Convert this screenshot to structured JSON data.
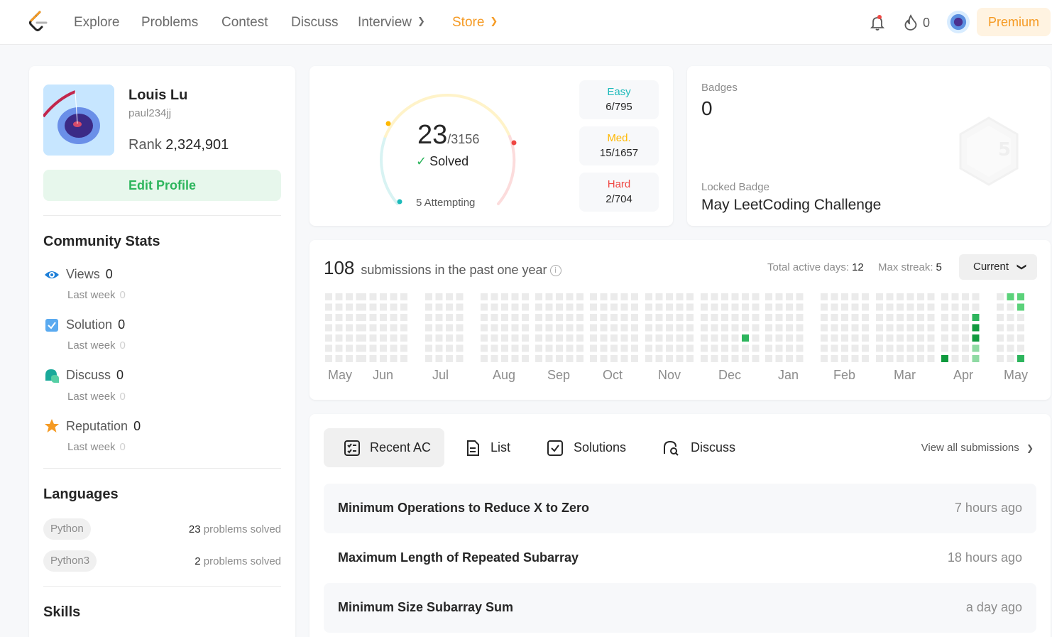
{
  "nav": {
    "items": [
      {
        "label": "Explore"
      },
      {
        "label": "Problems"
      },
      {
        "label": "Contest"
      },
      {
        "label": "Discuss"
      },
      {
        "label": "Interview"
      },
      {
        "label": "Store"
      }
    ],
    "streak_count": "0",
    "premium_label": "Premium",
    "accent_color": "#f59a23",
    "icons": [
      "leetcode-logo",
      "bell-icon",
      "flame-icon",
      "avatar"
    ]
  },
  "profile": {
    "name": "Louis Lu",
    "username": "paul234jj",
    "rank_label": "Rank",
    "rank_value": "2,324,901",
    "edit_label": "Edit Profile"
  },
  "community": {
    "title": "Community Stats",
    "stats": [
      {
        "label": "Views",
        "value": "0",
        "sub_label": "Last week",
        "sub_value": "0",
        "icon": "eye-icon"
      },
      {
        "label": "Solution",
        "value": "0",
        "sub_label": "Last week",
        "sub_value": "0",
        "icon": "solution-icon"
      },
      {
        "label": "Discuss",
        "value": "0",
        "sub_label": "Last week",
        "sub_value": "0",
        "icon": "discuss-icon"
      },
      {
        "label": "Reputation",
        "value": "0",
        "sub_label": "Last week",
        "sub_value": "0",
        "icon": "star-icon"
      }
    ]
  },
  "languages": {
    "title": "Languages",
    "items": [
      {
        "name": "Python",
        "count": "23",
        "suffix": "problems solved"
      },
      {
        "name": "Python3",
        "count": "2",
        "suffix": "problems solved"
      }
    ]
  },
  "skills": {
    "title": "Skills"
  },
  "solved": {
    "count": "23",
    "total": "/3156",
    "label": "Solved",
    "attempting": "5 Attempting",
    "difficulties": [
      {
        "label": "Easy",
        "value": "6/795",
        "color": "#1cbaba"
      },
      {
        "label": "Med.",
        "value": "15/1657",
        "color": "#ffb800"
      },
      {
        "label": "Hard",
        "value": "2/704",
        "color": "#ef4743"
      }
    ]
  },
  "badges": {
    "title": "Badges",
    "count": "0",
    "locked_label": "Locked Badge",
    "locked_name": "May LeetCoding Challenge"
  },
  "submissions": {
    "count": "108",
    "label": "submissions in the past one year",
    "active_days_label": "Total active days:",
    "active_days": "12",
    "max_streak_label": "Max streak:",
    "max_streak": "5",
    "selector": "Current",
    "months": [
      "May",
      "Jun",
      "Jul",
      "Aug",
      "Sep",
      "Oct",
      "Nov",
      "Dec",
      "Jan",
      "Feb",
      "Mar",
      "Apr",
      "May"
    ]
  },
  "recent": {
    "tabs": [
      {
        "label": "Recent AC",
        "icon": "recent-ac-icon"
      },
      {
        "label": "List",
        "icon": "list-icon"
      },
      {
        "label": "Solutions",
        "icon": "solutions-icon"
      },
      {
        "label": "Discuss",
        "icon": "discuss-search-icon"
      }
    ],
    "view_all": "View all submissions",
    "items": [
      {
        "title": "Minimum Operations to Reduce X to Zero",
        "time": "7 hours ago"
      },
      {
        "title": "Maximum Length of Repeated Subarray",
        "time": "18 hours ago"
      },
      {
        "title": "Minimum Size Subarray Sum",
        "time": "a day ago"
      }
    ]
  }
}
